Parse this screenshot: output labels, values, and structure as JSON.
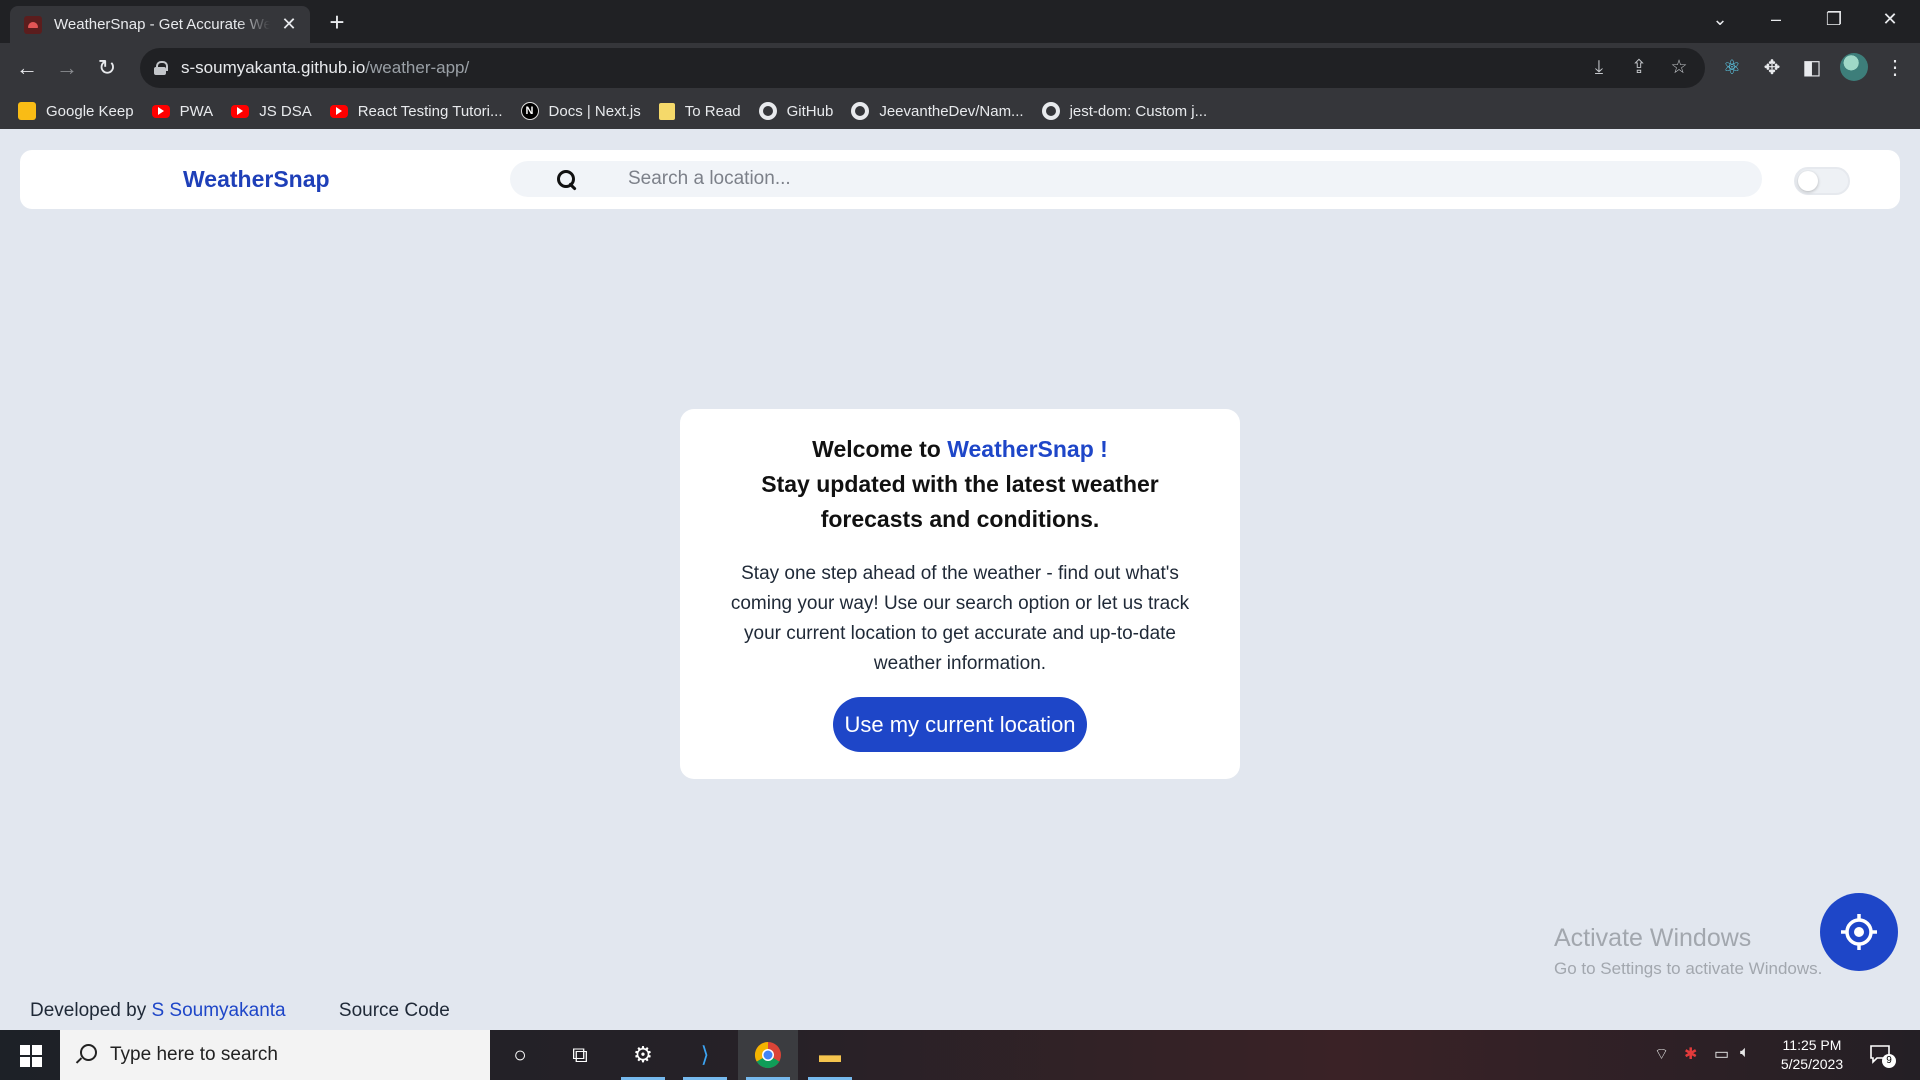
{
  "browser": {
    "tab_title": "WeatherSnap - Get Accurate Weather Forecasts",
    "url_host": "s-soumyakanta.github.io",
    "url_path": "/weather-app/",
    "bookmarks": [
      {
        "label": "Google Keep",
        "icon": "google-keep-icon"
      },
      {
        "label": "PWA",
        "icon": "youtube-icon"
      },
      {
        "label": "JS DSA",
        "icon": "youtube-icon"
      },
      {
        "label": "React Testing Tutori...",
        "icon": "youtube-icon"
      },
      {
        "label": "Docs | Next.js",
        "icon": "nextjs-icon"
      },
      {
        "label": "To Read",
        "icon": "folder-icon"
      },
      {
        "label": "GitHub",
        "icon": "github-icon"
      },
      {
        "label": "JeevantheDev/Nam...",
        "icon": "github-icon"
      },
      {
        "label": "jest-dom: Custom j...",
        "icon": "github-icon"
      }
    ]
  },
  "header": {
    "brand": "WeatherSnap",
    "search_placeholder": "Search a location..."
  },
  "welcome": {
    "prefix": "Welcome to ",
    "brand": "WeatherSnap !",
    "subheading": "Stay updated with the latest weather forecasts and conditions.",
    "description": "Stay one step ahead of the weather - find out what's coming your way! Use our search option or let us track your current location to get accurate and up-to-date weather information.",
    "cta_label": "Use my current location"
  },
  "watermark": {
    "title": "Activate Windows",
    "subtitle": "Go to Settings to activate Windows."
  },
  "footer": {
    "developed_by": "Developed by ",
    "author": "S Soumyakanta",
    "source_code": "Source Code"
  },
  "taskbar": {
    "search_placeholder": "Type here to search",
    "time": "11:25 PM",
    "date": "5/25/2023",
    "notification_count": "9"
  },
  "colors": {
    "accent": "#1e46c8",
    "page_bg": "#e2e7ef"
  }
}
